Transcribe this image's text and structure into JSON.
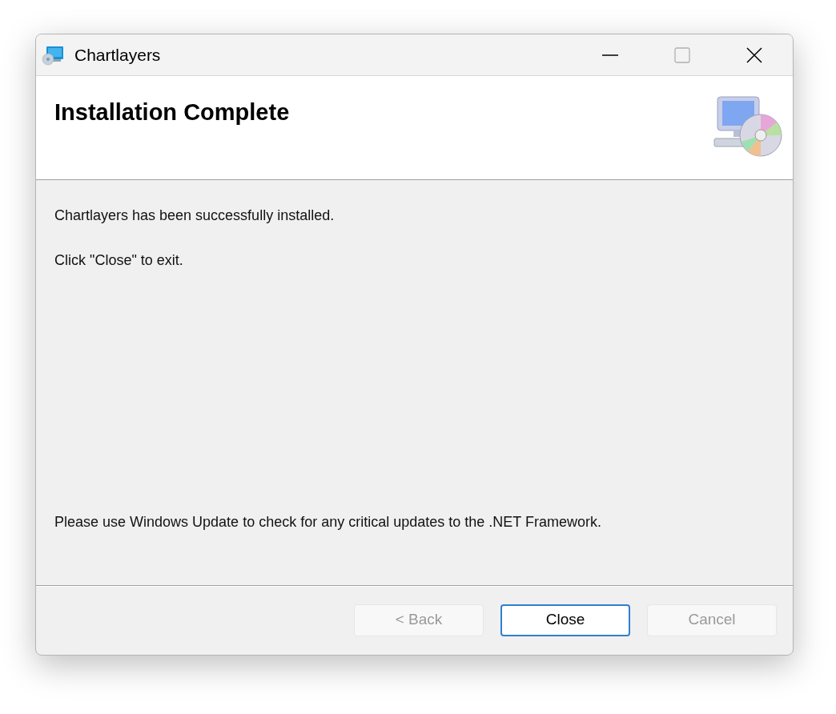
{
  "window": {
    "title": "Chartlayers"
  },
  "header": {
    "title": "Installation Complete"
  },
  "messages": [
    "Chartlayers has been successfully installed.",
    "Click \"Close\" to exit."
  ],
  "note": "Please use Windows Update to check for any critical updates to the .NET Framework.",
  "buttons": [
    {
      "label": "< Back",
      "disabled": true,
      "default": false
    },
    {
      "label": "Close",
      "disabled": false,
      "default": true
    },
    {
      "label": "Cancel",
      "disabled": true,
      "default": false
    }
  ]
}
